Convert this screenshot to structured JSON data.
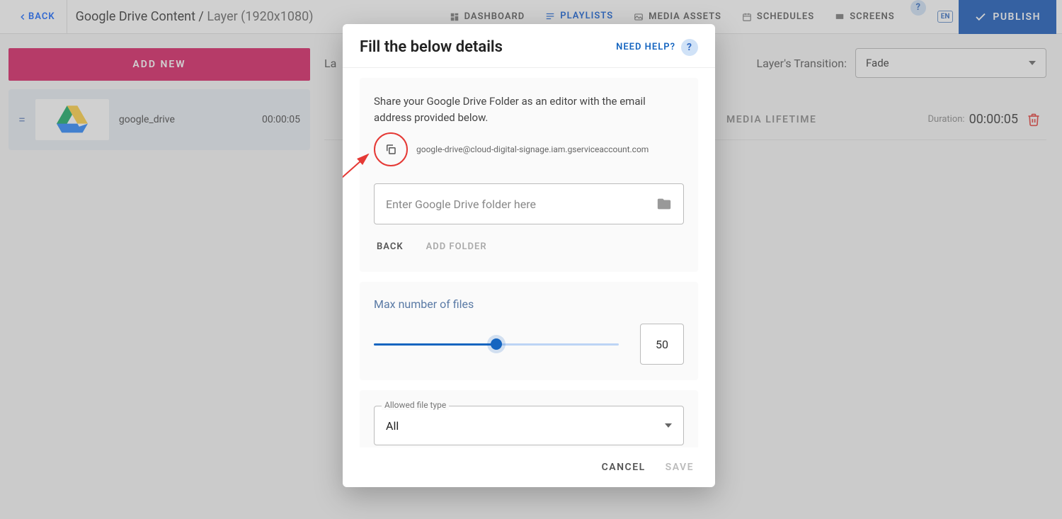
{
  "topbar": {
    "back": "BACK",
    "title": "Google Drive Content / ",
    "subtitle": "Layer (1920x1080)",
    "nav": {
      "dashboard": "DASHBOARD",
      "playlists": "PLAYLISTS",
      "media": "MEDIA ASSETS",
      "schedules": "SCHEDULES",
      "screens": "SCREENS"
    },
    "lang": "EN",
    "publish": "PUBLISH"
  },
  "side": {
    "add": "ADD NEW",
    "item": {
      "name": "google_drive",
      "time": "00:00:05"
    }
  },
  "main": {
    "layerPrefix": "La",
    "transition_label": "Layer's Transition:",
    "transition_value": "Fade",
    "media_lifetime": "MEDIA LIFETIME",
    "duration_label": "Duration:",
    "duration_value": "00:00:05"
  },
  "modal": {
    "title": "Fill the below details",
    "need_help": "NEED HELP?",
    "share_text": "Share your Google Drive Folder as an editor with the email address provided below.",
    "email": "google-drive@cloud-digital-signage.iam.gserviceaccount.com",
    "folder_placeholder": "Enter Google Drive folder here",
    "back": "BACK",
    "add_folder": "ADD FOLDER",
    "max_files_label": "Max number of files",
    "max_files_value": "50",
    "allowed_label": "Allowed file type",
    "allowed_value": "All",
    "cancel": "CANCEL",
    "save": "SAVE"
  }
}
